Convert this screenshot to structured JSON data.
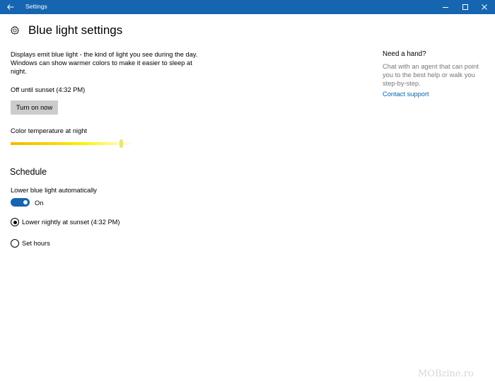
{
  "window": {
    "title": "Settings"
  },
  "page": {
    "title": "Blue light settings",
    "description": "Displays emit blue light - the kind of light you see during the day. Windows can show warmer colors to make it easier to sleep at night.",
    "status": "Off until sunset (4:32 PM)",
    "turn_on_button": "Turn on now",
    "color_temp_label": "Color temperature at night",
    "color_temp_value": 0.92
  },
  "schedule": {
    "heading": "Schedule",
    "auto_label": "Lower blue light automatically",
    "toggle_state": "On",
    "options": [
      {
        "label": "Lower nightly at sunset (4:32 PM)",
        "selected": true
      },
      {
        "label": "Set hours",
        "selected": false
      }
    ]
  },
  "help": {
    "title": "Need a hand?",
    "body": "Chat with an agent that can point you to the best help or walk you step-by-step.",
    "link": "Contact support"
  },
  "watermark": "MOBzine.ro",
  "colors": {
    "accent": "#1565b0",
    "link": "#0063b1",
    "button": "#cccccc"
  },
  "icons": [
    "back-arrow-icon",
    "minimize-icon",
    "maximize-icon",
    "close-icon",
    "gear-icon"
  ]
}
